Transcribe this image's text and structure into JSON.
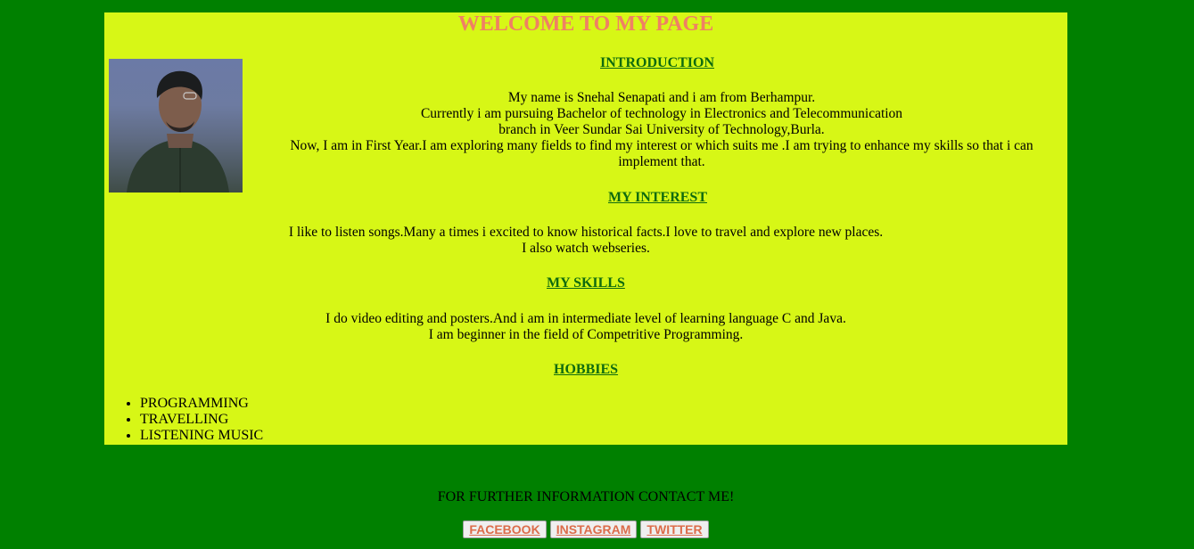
{
  "page": {
    "title": "WELCOME TO MY PAGE"
  },
  "introduction": {
    "heading": "INTRODUCTION",
    "lines": [
      "My name is Snehal Senapati and i am from Berhampur.",
      "Currently i am pursuing Bachelor of technology in Electronics and Telecommunication",
      "branch in Veer Sundar Sai University of Technology,Burla.",
      "Now, I am in First Year.I am exploring many fields to find my interest or which suits me .I am trying to enhance my skills so that i can",
      "implement that."
    ]
  },
  "interest": {
    "heading": "MY INTEREST",
    "lines": [
      "I like to listen songs.Many a times i excited to know historical facts.I love to travel and explore new places.",
      "I also watch webseries."
    ]
  },
  "skills": {
    "heading": "MY SKILLS",
    "lines": [
      "I do video editing and posters.And i am in intermediate level of learning language C and Java.",
      "I am beginner in the field of Competritive Programming."
    ]
  },
  "hobbies": {
    "heading": "HOBBIES",
    "items": [
      "PROGRAMMING",
      "TRAVELLING",
      "LISTENING MUSIC"
    ]
  },
  "contact": {
    "text": "FOR FURTHER INFORMATION CONTACT ME!",
    "buttons": [
      "FACEBOOK",
      "INSTAGRAM",
      "TWITTER"
    ]
  },
  "colors": {
    "background": "#008000",
    "panel": "#d7f716",
    "title": "#f08064",
    "heading": "#0f6b0f",
    "button_text": "#dc6c4a"
  }
}
